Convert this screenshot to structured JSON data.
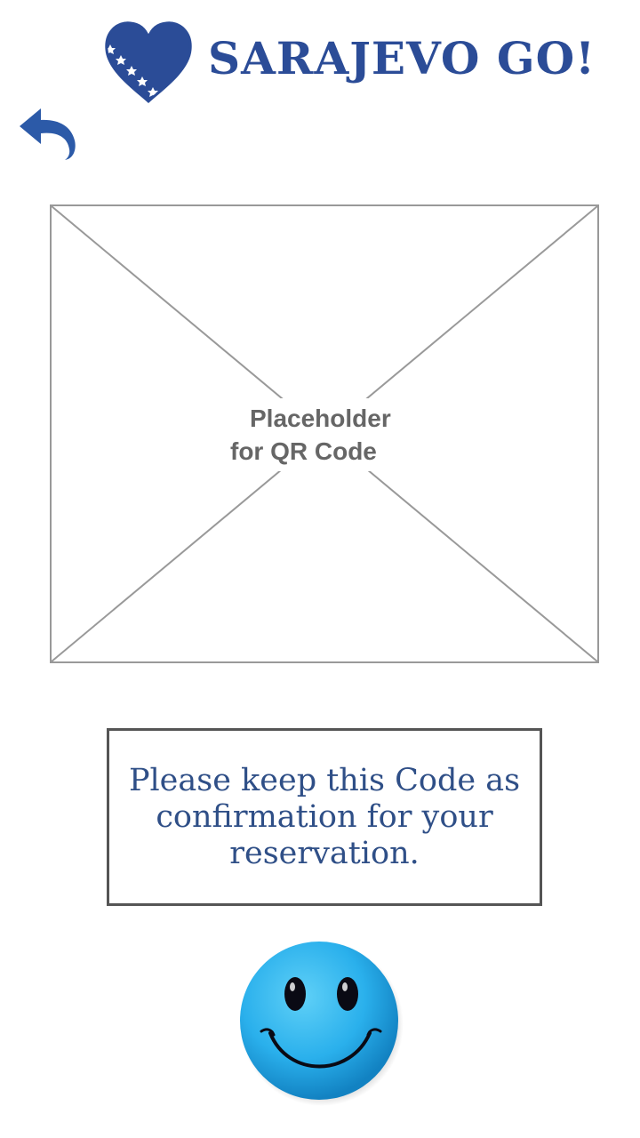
{
  "header": {
    "logo_text": "SARAJEVO GO!",
    "logo_icon": "heart-flag-icon",
    "brand_color": "#2b4c97"
  },
  "nav": {
    "back_icon": "back-arrow-icon"
  },
  "qr": {
    "placeholder_line1": "Placeholder",
    "placeholder_line2": "for QR Code"
  },
  "confirmation": {
    "message": "Please keep this Code as confirmation for your reservation."
  },
  "footer": {
    "image": "blue-smiley-face"
  }
}
